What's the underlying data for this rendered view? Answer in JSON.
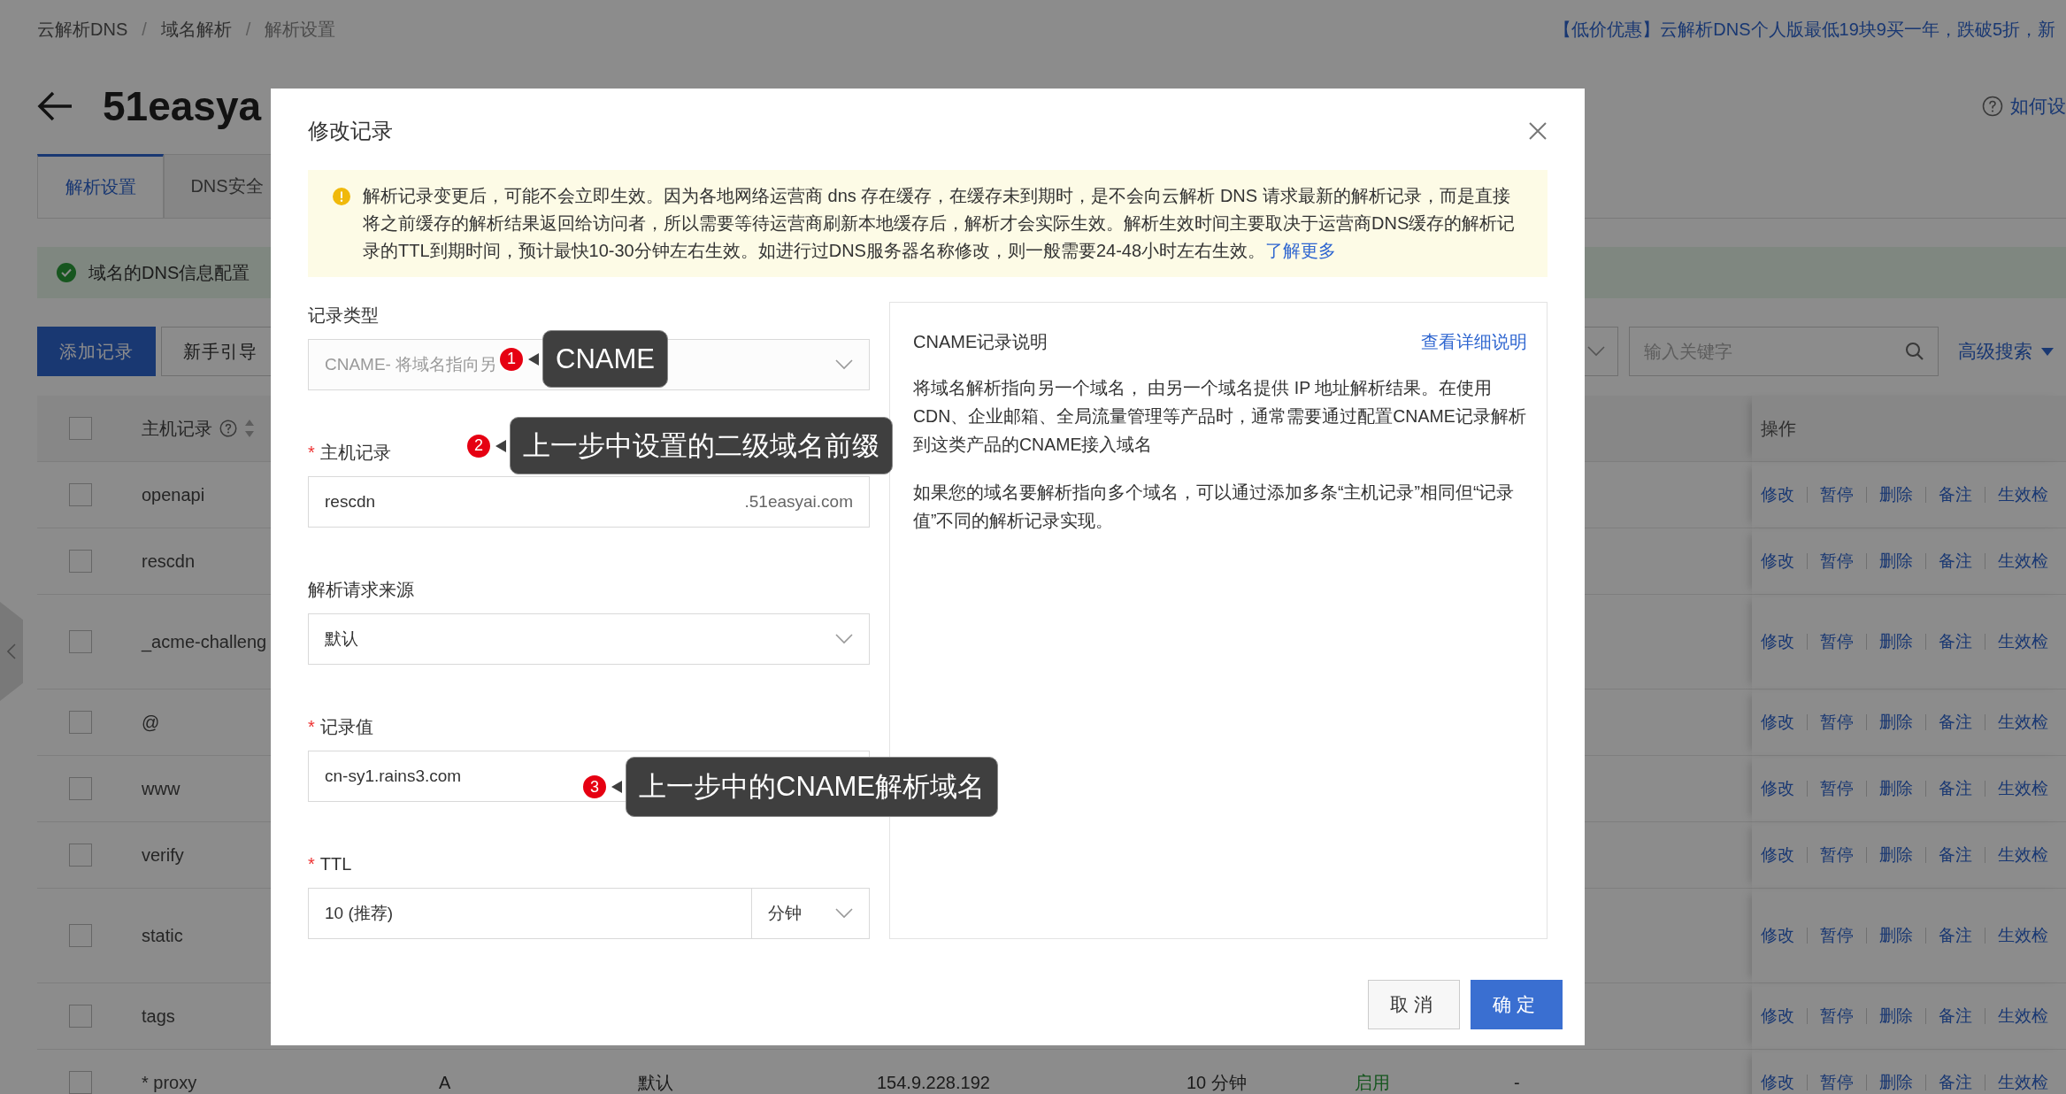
{
  "breadcrumb": [
    "云解析DNS",
    "域名解析",
    "解析设置"
  ],
  "breadcrumb_separator": "/",
  "promo": "【低价优惠】云解析DNS个人版最低19块9买一年，跌破5折，新",
  "domain_title": "51easya",
  "help_link": "如何设",
  "tabs": [
    {
      "label": "解析设置",
      "selected": true
    },
    {
      "label": "DNS安全",
      "selected": false
    }
  ],
  "status_alert": "域名的DNS信息配置",
  "toolbar": {
    "buttons": [
      {
        "label": "添加记录",
        "kind": "primary"
      },
      {
        "label": "新手引导",
        "kind": "default"
      }
    ],
    "search": {
      "placeholder": "输入关键字"
    },
    "advanced_search": "高级搜索"
  },
  "table": {
    "select_all_checked": false,
    "host_column": "主机记录",
    "actions_column": "操作",
    "rows": [
      {
        "checked": false,
        "host": "openapi",
        "actions": [
          "修改",
          "暂停",
          "删除",
          "备注",
          "生效检"
        ]
      },
      {
        "checked": false,
        "host": "rescdn",
        "actions": [
          "修改",
          "暂停",
          "删除",
          "备注",
          "生效检"
        ]
      },
      {
        "checked": false,
        "host": "_acme-challeng",
        "actions": [
          "修改",
          "暂停",
          "删除",
          "备注",
          "生效检"
        ]
      },
      {
        "checked": false,
        "host": "@",
        "actions": [
          "修改",
          "暂停",
          "删除",
          "备注",
          "生效检"
        ]
      },
      {
        "checked": false,
        "host": "www",
        "actions": [
          "修改",
          "暂停",
          "删除",
          "备注",
          "生效检"
        ]
      },
      {
        "checked": false,
        "host": "verify",
        "actions": [
          "修改",
          "暂停",
          "删除",
          "备注",
          "生效检"
        ]
      },
      {
        "checked": false,
        "host": "static",
        "actions": [
          "修改",
          "暂停",
          "删除",
          "备注",
          "生效检"
        ]
      },
      {
        "checked": false,
        "host": "tags",
        "actions": [
          "修改",
          "暂停",
          "删除",
          "备注",
          "生效检"
        ]
      },
      {
        "checked": false,
        "host": "* proxy",
        "type": "A",
        "line": "默认",
        "value": "154.9.228.192",
        "ttl": "10 分钟",
        "status": "启用",
        "remark": "-",
        "actions": [
          "修改",
          "暂停",
          "删除",
          "备注",
          "生效检"
        ]
      }
    ]
  },
  "dialog": {
    "title": "修改记录",
    "notice": {
      "text": "解析记录变更后，可能不会立即生效。因为各地网络运营商 dns 存在缓存，在缓存未到期时，是不会向云解析 DNS 请求最新的解析记录，而是直接将之前缓存的解析结果返回给访问者，所以需要等待运营商刷新本地缓存后，解析才会实际生效。解析生效时间主要取决于运营商DNS缓存的解析记录的TTL到期时间，预计最快10-30分钟左右生效。如进行过DNS服务器名称修改，则一般需要24-48小时左右生效。",
      "link": "了解更多"
    },
    "fields": [
      {
        "kind": "select",
        "label": "记录类型",
        "disabled": true,
        "value": "CNAME- 将域名指向另",
        "callout": {
          "number": "1",
          "text": "CNAME"
        }
      },
      {
        "kind": "suffix-input",
        "label": "主机记录",
        "required_mark": "*",
        "disabled": false,
        "value": "rescdn",
        "suffix": ".51easyai.com",
        "callout": {
          "number": "2",
          "text": "上一步中设置的二级域名前缀"
        }
      },
      {
        "kind": "select",
        "label": "解析请求来源",
        "disabled": false,
        "value": "默认"
      },
      {
        "kind": "input",
        "label": "记录值",
        "required_mark": "*",
        "disabled": false,
        "value": "cn-sy1.rains3.com",
        "callout": {
          "number": "3",
          "text": "上一步中的CNAME解析域名"
        }
      },
      {
        "kind": "ttl",
        "label": "TTL",
        "required_mark": "*",
        "disabled": false,
        "value": "10 (推荐)",
        "unit": "分钟"
      }
    ],
    "help_panel": {
      "title": "CNAME记录说明",
      "link": "查看详细说明",
      "paragraphs": [
        "将域名解析指向另一个域名， 由另一个域名提供 IP 地址解析结果。在使用CDN、企业邮箱、全局流量管理等产品时，通常需要通过配置CNAME记录解析到这类产品的CNAME接入域名",
        "如果您的域名要解析指向多个域名，可以通过添加多条“主机记录”相同但“记录值”不同的解析记录实现。"
      ]
    },
    "buttons": [
      {
        "label": "取消",
        "kind": "default"
      },
      {
        "label": "确定",
        "kind": "primary"
      }
    ]
  }
}
